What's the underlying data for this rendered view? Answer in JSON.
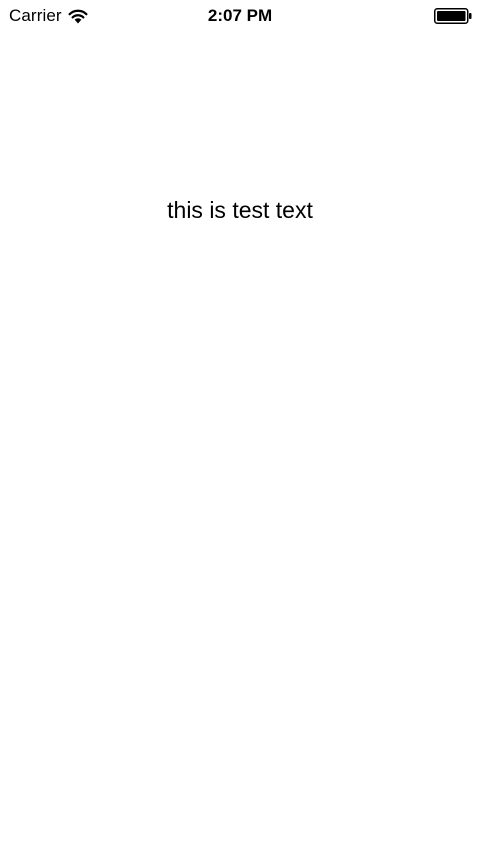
{
  "status_bar": {
    "carrier": "Carrier",
    "time": "2:07 PM",
    "wifi_icon": "wifi-icon",
    "battery_icon": "battery-full-icon"
  },
  "main": {
    "text": "this is test text"
  }
}
